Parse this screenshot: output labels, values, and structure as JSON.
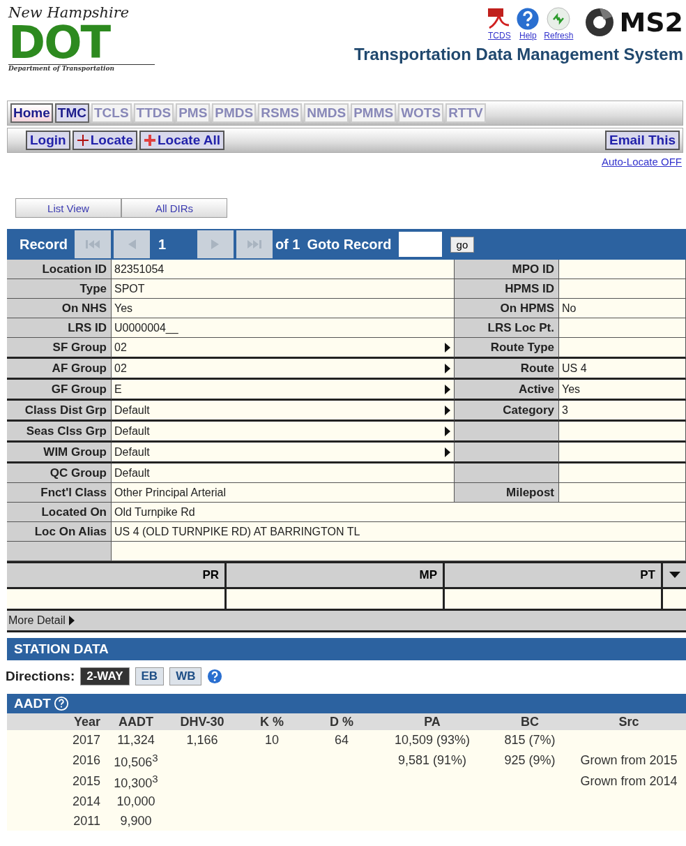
{
  "logo": {
    "script": "New Hampshire",
    "letters": "DOT",
    "subtitle": "Department of Transportation"
  },
  "header_links": [
    {
      "kind": "pdf",
      "label": "TCDS"
    },
    {
      "kind": "help",
      "label": "Help"
    },
    {
      "kind": "refresh",
      "label": "Refresh"
    }
  ],
  "brand": {
    "name": "MS2",
    "title": "Transportation Data Management System"
  },
  "modules": [
    {
      "label": "Home",
      "disabled": false,
      "selected": true
    },
    {
      "label": "TMC",
      "disabled": false,
      "selected": false
    },
    {
      "label": "TCLS",
      "disabled": true,
      "selected": false
    },
    {
      "label": "TTDS",
      "disabled": true,
      "selected": false
    },
    {
      "label": "PMS",
      "disabled": true,
      "selected": false
    },
    {
      "label": "PMDS",
      "disabled": true,
      "selected": false
    },
    {
      "label": "RSMS",
      "disabled": true,
      "selected": false
    },
    {
      "label": "NMDS",
      "disabled": true,
      "selected": false
    },
    {
      "label": "PMMS",
      "disabled": true,
      "selected": false
    },
    {
      "label": "WOTS",
      "disabled": true,
      "selected": false
    },
    {
      "label": "RTTV",
      "disabled": true,
      "selected": false
    }
  ],
  "toolbar": [
    {
      "kind": "plain",
      "label": "Login"
    },
    {
      "kind": "locate",
      "label": "Locate"
    },
    {
      "kind": "locate_all",
      "label": "Locate All"
    }
  ],
  "email_button": "Email This",
  "auto_locate": "Auto-Locate OFF",
  "view_buttons": [
    "List View",
    "All DIRs"
  ],
  "record_bar": {
    "label": "Record",
    "nav": [
      {
        "kind": "first",
        "disabled": true
      },
      {
        "kind": "prev",
        "disabled": true
      },
      {
        "kind": "current",
        "label": "1"
      },
      {
        "kind": "next",
        "disabled": true
      },
      {
        "kind": "last",
        "disabled": true
      }
    ],
    "of": "of 1",
    "goto": "Goto Record",
    "go": "go"
  },
  "detail_rows": [
    {
      "label": "Location ID",
      "value": "82351054",
      "has_arrow": false,
      "right_label": "MPO ID"
    },
    {
      "label": "Type",
      "value": "SPOT",
      "has_arrow": false,
      "right_label": "HPMS ID"
    },
    {
      "label": "On NHS",
      "value": "Yes",
      "has_arrow": false,
      "right_label": "On HPMS",
      "right_value": "No"
    },
    {
      "label": "LRS ID",
      "value": "U0000004__",
      "has_arrow": false,
      "right_label": "LRS Loc Pt."
    },
    {
      "label": "SF Group",
      "value": "02",
      "has_arrow": true,
      "right_label": "Route Type"
    },
    {
      "label": "AF Group",
      "value": "02",
      "has_arrow": true,
      "right_label": "Route",
      "right_value": "US 4"
    },
    {
      "label": "GF Group",
      "value": "E",
      "has_arrow": true,
      "right_label": "Active",
      "right_value": "Yes"
    },
    {
      "label": "Class Dist Grp",
      "value": "Default",
      "has_arrow": true,
      "right_label": "Category",
      "right_value": "3"
    },
    {
      "label": "Seas Clss Grp",
      "value": "Default",
      "has_arrow": true
    },
    {
      "label": "WIM Group",
      "value": "Default",
      "has_arrow": true
    },
    {
      "label": "QC Group",
      "value": "Default",
      "has_arrow": false
    },
    {
      "label": "Fnct'l Class",
      "value": "Other Principal Arterial",
      "has_arrow": false,
      "right_label": "Milepost"
    },
    {
      "label": "Located On",
      "value": "Old Turnpike Rd",
      "has_arrow": false,
      "wide": true
    },
    {
      "label": "Loc On Alias",
      "value": "US 4 (OLD TURNPIKE RD) AT BARRINGTON TL",
      "has_arrow": false,
      "wide": true
    }
  ],
  "lrs_columns": [
    "PR",
    "MP",
    "PT"
  ],
  "more_detail": "More Detail",
  "station_title": "STATION DATA",
  "directions": {
    "label": "Directions:",
    "options": [
      {
        "label": "2-WAY",
        "selected": true
      },
      {
        "label": "EB",
        "selected": false
      },
      {
        "label": "WB",
        "selected": false
      }
    ]
  },
  "aadt": {
    "title": "AADT",
    "columns": [
      "Year",
      "AADT",
      "DHV-30",
      "K %",
      "D %",
      "PA",
      "BC",
      "Src"
    ],
    "rows": [
      [
        "2017",
        "11,324",
        "1,166",
        "10",
        "64",
        "10,509 (93%)",
        "815 (7%)",
        ""
      ],
      [
        "2016",
        "10,506$^{3}$",
        "",
        "",
        "",
        "9,581 (91%)",
        "925 (9%)",
        "Grown from 2015"
      ],
      [
        "2015",
        "10,300$^{3}$",
        "",
        "",
        "",
        "",
        "",
        "Grown from 2014"
      ],
      [
        "2014",
        "10,000",
        "",
        "",
        "",
        "",
        "",
        ""
      ],
      [
        "2011",
        "9,900",
        "",
        "",
        "",
        "",
        "",
        ""
      ]
    ]
  }
}
